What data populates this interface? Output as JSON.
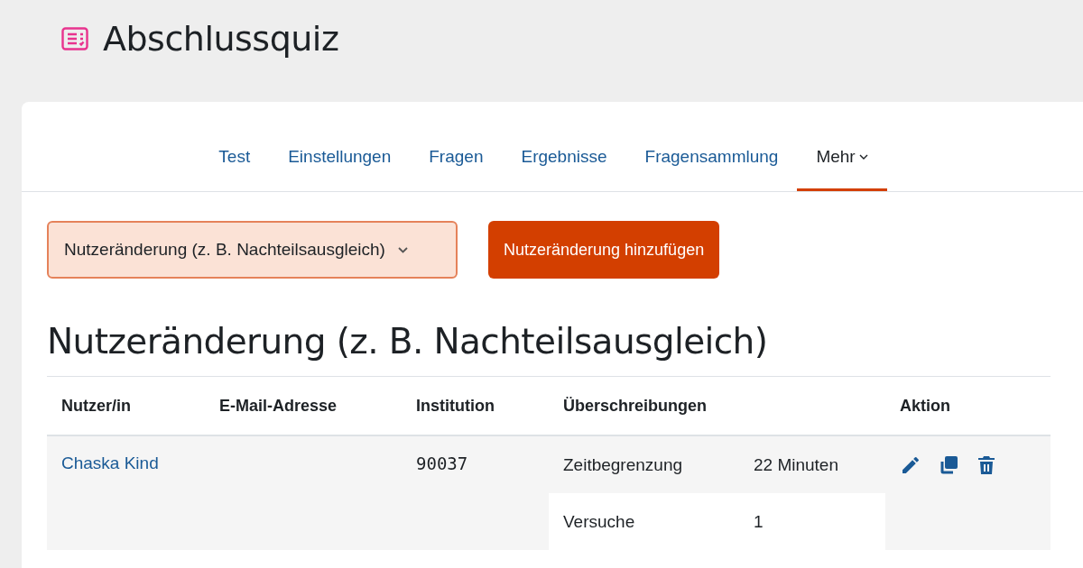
{
  "page_title": "Abschlussquiz",
  "tabs": [
    {
      "label": "Test",
      "selected": false
    },
    {
      "label": "Einstellungen",
      "selected": false
    },
    {
      "label": "Fragen",
      "selected": false
    },
    {
      "label": "Ergebnisse",
      "selected": false
    },
    {
      "label": "Fragensammlung",
      "selected": false
    },
    {
      "label": "Mehr",
      "selected": true,
      "kind": "dropdown"
    }
  ],
  "mode_select": {
    "value": "Nutzeränderung (z. B. Nachteilsausgleich)"
  },
  "add_button": "Nutzeränderung hinzufügen",
  "heading": "Nutzeränderung (z. B. Nachteilsausgleich)",
  "table": {
    "columns": [
      "Nutzer/in",
      "E-Mail-Adresse",
      "Institution",
      "Überschreibungen",
      "Aktion"
    ],
    "rows": [
      {
        "user": "Chaska Kind",
        "institution": "90037",
        "overrides": [
          {
            "setting": "Zeitbegrenzung",
            "value": "22 Minuten"
          },
          {
            "setting": "Versuche",
            "value": "1"
          }
        ]
      }
    ]
  }
}
